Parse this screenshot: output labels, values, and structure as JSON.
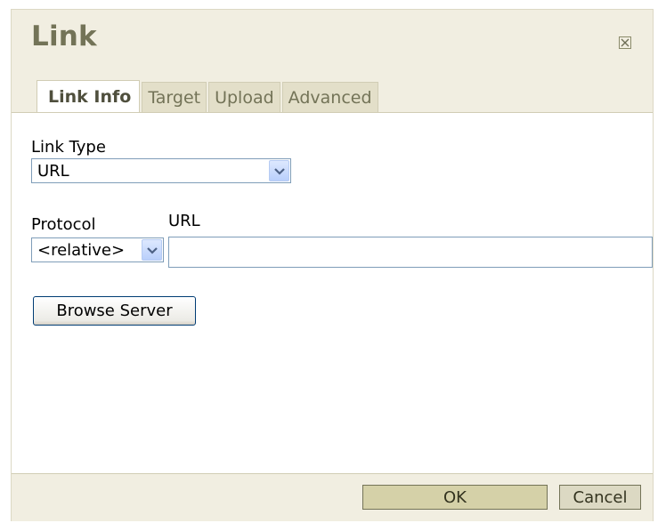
{
  "dialog": {
    "title": "Link",
    "close_icon": "close-icon"
  },
  "tabs": [
    {
      "label": "Link Info",
      "active": true
    },
    {
      "label": "Target",
      "active": false
    },
    {
      "label": "Upload",
      "active": false
    },
    {
      "label": "Advanced",
      "active": false
    }
  ],
  "form": {
    "link_type": {
      "label": "Link Type",
      "selected": "URL"
    },
    "protocol": {
      "label": "Protocol",
      "selected": "<relative>"
    },
    "url": {
      "label": "URL",
      "value": ""
    },
    "browse_label": "Browse Server"
  },
  "footer": {
    "ok_label": "OK",
    "cancel_label": "Cancel"
  },
  "colors": {
    "title": "#737357",
    "dialog_bg": "#f1eee1",
    "panel_bg": "#ffffff",
    "field_border": "#7f9db9"
  }
}
